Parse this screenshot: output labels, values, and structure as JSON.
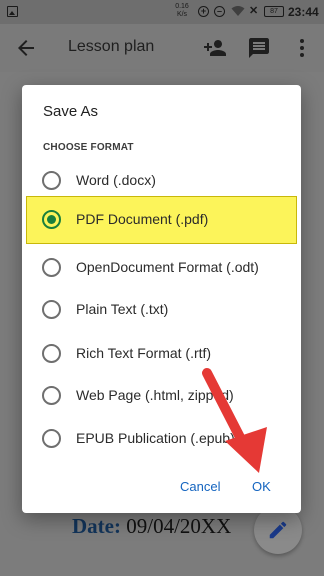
{
  "status_bar": {
    "speed_top": "0.16",
    "speed_bottom": "K/s",
    "battery": "87",
    "time": "23:44"
  },
  "app_bar": {
    "title": "Lesson plan"
  },
  "document": {
    "date_label": "Date:",
    "date_value": "09/04/20XX"
  },
  "dialog": {
    "title": "Save As",
    "section": "CHOOSE FORMAT",
    "options": [
      {
        "label": "Word (.docx)",
        "selected": false
      },
      {
        "label": "PDF Document (.pdf)",
        "selected": true
      },
      {
        "label": "OpenDocument Format (.odt)",
        "selected": false
      },
      {
        "label": "Plain Text (.txt)",
        "selected": false
      },
      {
        "label": "Rich Text Format (.rtf)",
        "selected": false
      },
      {
        "label": "Web Page (.html, zipped)",
        "selected": false
      },
      {
        "label": "EPUB Publication (.epub)",
        "selected": false
      }
    ],
    "cancel": "Cancel",
    "ok": "OK"
  },
  "colors": {
    "highlight": "#fcf45a",
    "accent": "#1565c0",
    "radio_selected": "#1a7f3c",
    "annotation_arrow": "#e53935"
  }
}
